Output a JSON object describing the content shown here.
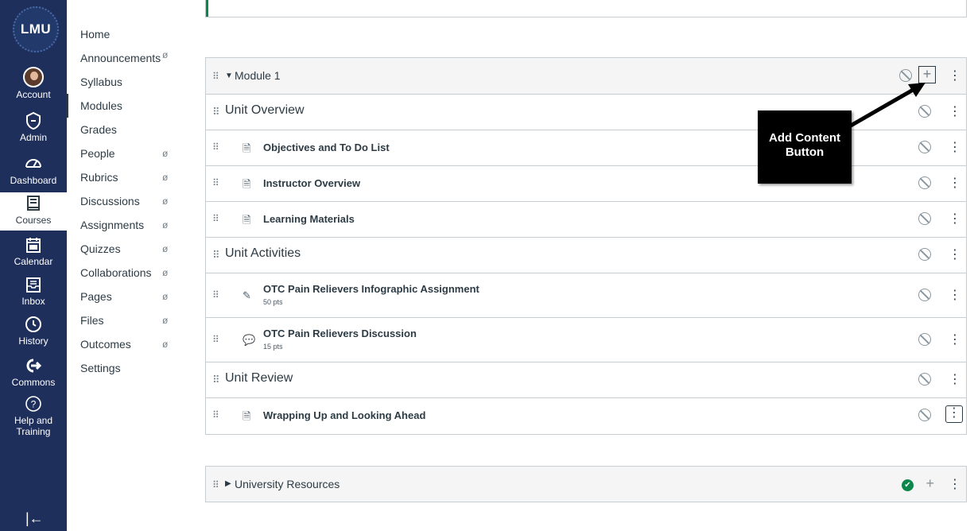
{
  "global_nav": {
    "logo": "LMU",
    "items": [
      {
        "label": "Account",
        "icon": "avatar"
      },
      {
        "label": "Admin",
        "icon": "shield-icon"
      },
      {
        "label": "Dashboard",
        "icon": "dashboard-icon"
      },
      {
        "label": "Courses",
        "icon": "book-icon"
      },
      {
        "label": "Calendar",
        "icon": "calendar-icon"
      },
      {
        "label": "Inbox",
        "icon": "inbox-icon"
      },
      {
        "label": "History",
        "icon": "clock-icon"
      },
      {
        "label": "Commons",
        "icon": "commons-icon"
      },
      {
        "label": "Help and",
        "label2": "Training",
        "icon": "help-icon"
      }
    ],
    "collapse": "|←"
  },
  "course_nav": {
    "items": [
      {
        "label": "Home",
        "hidden": false
      },
      {
        "label": "Announcements",
        "hidden": true
      },
      {
        "label": "Syllabus",
        "hidden": false
      },
      {
        "label": "Modules",
        "hidden": false,
        "active": true
      },
      {
        "label": "Grades",
        "hidden": false
      },
      {
        "label": "People",
        "hidden": true
      },
      {
        "label": "Rubrics",
        "hidden": true
      },
      {
        "label": "Discussions",
        "hidden": true
      },
      {
        "label": "Assignments",
        "hidden": true
      },
      {
        "label": "Quizzes",
        "hidden": true
      },
      {
        "label": "Collaborations",
        "hidden": true
      },
      {
        "label": "Pages",
        "hidden": true
      },
      {
        "label": "Files",
        "hidden": true
      },
      {
        "label": "Outcomes",
        "hidden": true
      },
      {
        "label": "Settings",
        "hidden": false
      }
    ]
  },
  "module1": {
    "title": "Module 1",
    "rows": [
      {
        "type": "header",
        "title": "Unit Overview"
      },
      {
        "type": "page",
        "title": "Objectives and To Do List"
      },
      {
        "type": "page",
        "title": "Instructor Overview"
      },
      {
        "type": "page",
        "title": "Learning Materials"
      },
      {
        "type": "header",
        "title": "Unit Activities"
      },
      {
        "type": "assignment",
        "title": "OTC Pain Relievers Infographic Assignment",
        "pts": "50 pts"
      },
      {
        "type": "discussion",
        "title": "OTC Pain Relievers Discussion",
        "pts": "15 pts"
      },
      {
        "type": "header",
        "title": "Unit Review"
      },
      {
        "type": "page",
        "title": "Wrapping Up and Looking Ahead"
      }
    ]
  },
  "callout": {
    "line1": "Add Content",
    "line2": "Button"
  },
  "module2": {
    "title": "University Resources",
    "published": true
  }
}
